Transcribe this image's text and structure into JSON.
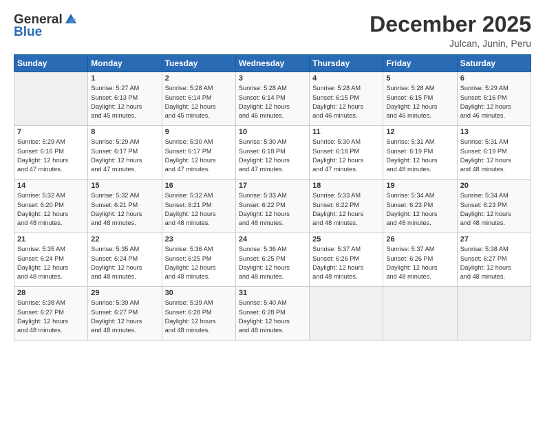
{
  "header": {
    "logo_line1": "General",
    "logo_line2": "Blue",
    "month": "December 2025",
    "location": "Julcan, Junin, Peru"
  },
  "days_of_week": [
    "Sunday",
    "Monday",
    "Tuesday",
    "Wednesday",
    "Thursday",
    "Friday",
    "Saturday"
  ],
  "weeks": [
    [
      {
        "day": "",
        "info": ""
      },
      {
        "day": "1",
        "info": "Sunrise: 5:27 AM\nSunset: 6:13 PM\nDaylight: 12 hours\nand 45 minutes."
      },
      {
        "day": "2",
        "info": "Sunrise: 5:28 AM\nSunset: 6:14 PM\nDaylight: 12 hours\nand 45 minutes."
      },
      {
        "day": "3",
        "info": "Sunrise: 5:28 AM\nSunset: 6:14 PM\nDaylight: 12 hours\nand 46 minutes."
      },
      {
        "day": "4",
        "info": "Sunrise: 5:28 AM\nSunset: 6:15 PM\nDaylight: 12 hours\nand 46 minutes."
      },
      {
        "day": "5",
        "info": "Sunrise: 5:28 AM\nSunset: 6:15 PM\nDaylight: 12 hours\nand 46 minutes."
      },
      {
        "day": "6",
        "info": "Sunrise: 5:29 AM\nSunset: 6:16 PM\nDaylight: 12 hours\nand 46 minutes."
      }
    ],
    [
      {
        "day": "7",
        "info": "Sunrise: 5:29 AM\nSunset: 6:16 PM\nDaylight: 12 hours\nand 47 minutes."
      },
      {
        "day": "8",
        "info": "Sunrise: 5:29 AM\nSunset: 6:17 PM\nDaylight: 12 hours\nand 47 minutes."
      },
      {
        "day": "9",
        "info": "Sunrise: 5:30 AM\nSunset: 6:17 PM\nDaylight: 12 hours\nand 47 minutes."
      },
      {
        "day": "10",
        "info": "Sunrise: 5:30 AM\nSunset: 6:18 PM\nDaylight: 12 hours\nand 47 minutes."
      },
      {
        "day": "11",
        "info": "Sunrise: 5:30 AM\nSunset: 6:18 PM\nDaylight: 12 hours\nand 47 minutes."
      },
      {
        "day": "12",
        "info": "Sunrise: 5:31 AM\nSunset: 6:19 PM\nDaylight: 12 hours\nand 48 minutes."
      },
      {
        "day": "13",
        "info": "Sunrise: 5:31 AM\nSunset: 6:19 PM\nDaylight: 12 hours\nand 48 minutes."
      }
    ],
    [
      {
        "day": "14",
        "info": "Sunrise: 5:32 AM\nSunset: 6:20 PM\nDaylight: 12 hours\nand 48 minutes."
      },
      {
        "day": "15",
        "info": "Sunrise: 5:32 AM\nSunset: 6:21 PM\nDaylight: 12 hours\nand 48 minutes."
      },
      {
        "day": "16",
        "info": "Sunrise: 5:32 AM\nSunset: 6:21 PM\nDaylight: 12 hours\nand 48 minutes."
      },
      {
        "day": "17",
        "info": "Sunrise: 5:33 AM\nSunset: 6:22 PM\nDaylight: 12 hours\nand 48 minutes."
      },
      {
        "day": "18",
        "info": "Sunrise: 5:33 AM\nSunset: 6:22 PM\nDaylight: 12 hours\nand 48 minutes."
      },
      {
        "day": "19",
        "info": "Sunrise: 5:34 AM\nSunset: 6:23 PM\nDaylight: 12 hours\nand 48 minutes."
      },
      {
        "day": "20",
        "info": "Sunrise: 5:34 AM\nSunset: 6:23 PM\nDaylight: 12 hours\nand 48 minutes."
      }
    ],
    [
      {
        "day": "21",
        "info": "Sunrise: 5:35 AM\nSunset: 6:24 PM\nDaylight: 12 hours\nand 48 minutes."
      },
      {
        "day": "22",
        "info": "Sunrise: 5:35 AM\nSunset: 6:24 PM\nDaylight: 12 hours\nand 48 minutes."
      },
      {
        "day": "23",
        "info": "Sunrise: 5:36 AM\nSunset: 6:25 PM\nDaylight: 12 hours\nand 48 minutes."
      },
      {
        "day": "24",
        "info": "Sunrise: 5:36 AM\nSunset: 6:25 PM\nDaylight: 12 hours\nand 48 minutes."
      },
      {
        "day": "25",
        "info": "Sunrise: 5:37 AM\nSunset: 6:26 PM\nDaylight: 12 hours\nand 48 minutes."
      },
      {
        "day": "26",
        "info": "Sunrise: 5:37 AM\nSunset: 6:26 PM\nDaylight: 12 hours\nand 48 minutes."
      },
      {
        "day": "27",
        "info": "Sunrise: 5:38 AM\nSunset: 6:27 PM\nDaylight: 12 hours\nand 48 minutes."
      }
    ],
    [
      {
        "day": "28",
        "info": "Sunrise: 5:38 AM\nSunset: 6:27 PM\nDaylight: 12 hours\nand 48 minutes."
      },
      {
        "day": "29",
        "info": "Sunrise: 5:39 AM\nSunset: 6:27 PM\nDaylight: 12 hours\nand 48 minutes."
      },
      {
        "day": "30",
        "info": "Sunrise: 5:39 AM\nSunset: 6:28 PM\nDaylight: 12 hours\nand 48 minutes."
      },
      {
        "day": "31",
        "info": "Sunrise: 5:40 AM\nSunset: 6:28 PM\nDaylight: 12 hours\nand 48 minutes."
      },
      {
        "day": "",
        "info": ""
      },
      {
        "day": "",
        "info": ""
      },
      {
        "day": "",
        "info": ""
      }
    ]
  ]
}
